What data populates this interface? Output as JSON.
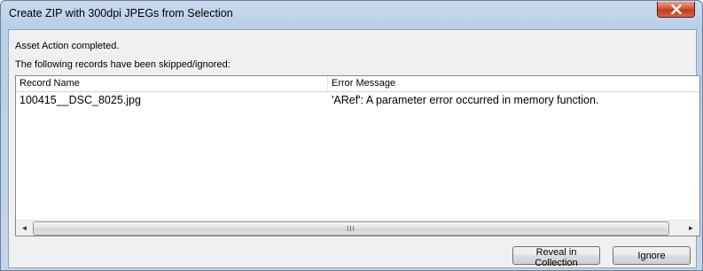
{
  "window": {
    "title": "Create ZIP with 300dpi JPEGs from Selection"
  },
  "status": {
    "completed": "Asset Action completed.",
    "skipped_notice": "The following records have been skipped/ignored:"
  },
  "table": {
    "columns": [
      "Record Name",
      "Error Message"
    ],
    "rows": [
      {
        "record_name": "100415__DSC_8025.jpg",
        "error": "'ARef': A parameter error occurred in memory function."
      }
    ]
  },
  "scrollbar": {
    "thumb_grip": "III",
    "left_arrow": "◄",
    "right_arrow": "►"
  },
  "buttons": {
    "reveal": "Reveal in Collection",
    "ignore": "Ignore"
  },
  "icons": {
    "close": "close-icon"
  }
}
